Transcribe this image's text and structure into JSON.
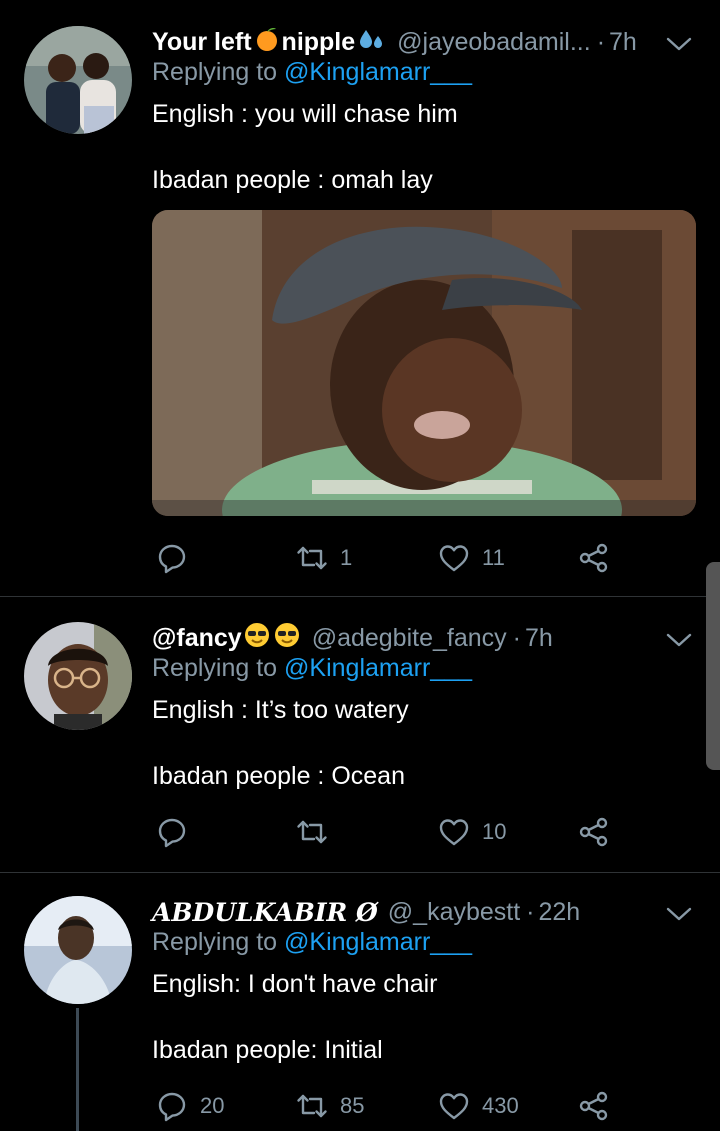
{
  "tweets": [
    {
      "display_name": "Your left",
      "display_name_2": "nipple",
      "handle": "@jayeobadamil...",
      "time": "7h",
      "replying_prefix": "Replying to",
      "replying_to": "@Kinglamarr___",
      "line1": "English : you will chase him",
      "line2": "Ibadan people : omah lay",
      "actions": {
        "reply": "",
        "retweet": "1",
        "like": "11"
      }
    },
    {
      "display_name": "@fancy",
      "handle": "@adegbite_fancy",
      "time": "7h",
      "replying_prefix": "Replying to",
      "replying_to": "@Kinglamarr___",
      "line1": "English : It’s too watery",
      "line2": "Ibadan people : Ocean",
      "actions": {
        "reply": "",
        "retweet": "",
        "like": "10"
      }
    },
    {
      "display_name": "ABDULKABIR Ø",
      "handle": "@_kaybestt",
      "time": "22h",
      "replying_prefix": "Replying to",
      "replying_to": "@Kinglamarr___",
      "line1": "English: I don't have chair",
      "line2": "Ibadan people: Initial",
      "actions": {
        "reply": "20",
        "retweet": "85",
        "like": "430"
      }
    }
  ],
  "colors": {
    "background": "#000000",
    "muted": "#8899a6",
    "link": "#1da1f2",
    "divider": "#2f3336"
  },
  "icons": [
    "chevron-down-icon",
    "reply-icon",
    "retweet-icon",
    "like-icon",
    "share-icon",
    "peach-emoji",
    "sweat-droplets-emoji",
    "sunglasses-emoji"
  ]
}
